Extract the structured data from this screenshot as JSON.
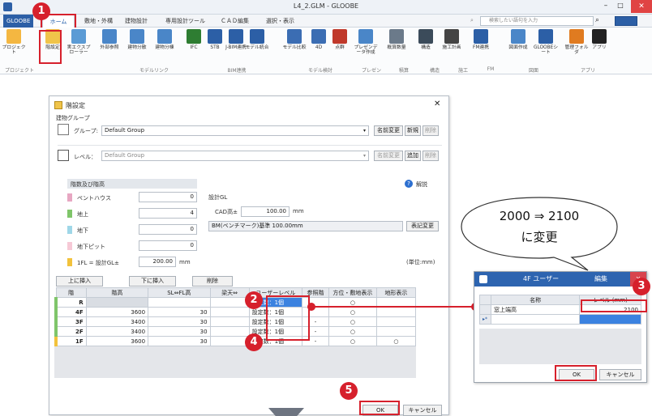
{
  "window_title": "L4_2.GLM - GLOOBE",
  "tabs": [
    "GLOOBE",
    "ホーム",
    "敷地・外構",
    "建物設計",
    "専用設計ツール",
    "ＣＡＤ編集",
    "選択・表示"
  ],
  "search_placeholder": "検索したい語句を入力",
  "ribbon": {
    "buttons": [
      "プロジェクト",
      "階設定",
      "実エクスプローラー",
      "外部参照",
      "建物分散",
      "建物分棟",
      "IFC",
      "STB",
      "J-BIM連携",
      "モデル統合",
      "モデル比較",
      "4D",
      "点群",
      "プレゼンデータ作成",
      "概算数量",
      "構造",
      "施工計画",
      "FM連携",
      "図面作成",
      "GLOOBEシート",
      "管理フォルダ",
      "アプリ"
    ],
    "groups": [
      "プロジェクト",
      "モデルリンク",
      "BIM連携",
      "モデル検討",
      "プレゼン",
      "積算",
      "構造",
      "施工",
      "FM",
      "図面",
      "アプリ"
    ]
  },
  "dialog": {
    "title": "階設定",
    "building_group_label": "建物グループ",
    "group_label": "グループ:",
    "group_value": "Default Group",
    "rename_btn": "名前変更",
    "new_btn": "新規",
    "delete_btn": "削除",
    "level_label": "レベル：",
    "level_value": "Default Group",
    "add_btn": "追加",
    "floors_header": "階数及び階高",
    "help": "解説",
    "penthouse_label": "ペントハウス",
    "penthouse_value": "0",
    "above_label": "地上",
    "above_value": "4",
    "below_label": "地下",
    "below_value": "0",
    "pit_label": "地下ピット",
    "pit_value": "0",
    "fl_label": "1FL = 設計GL±",
    "fl_value": "200.00",
    "fl_unit": "mm",
    "design_gl_label": "設計GL",
    "cad_label": "CAD高±",
    "cad_value": "100.00",
    "cad_unit": "mm",
    "bm_text": "BM(ベンチマーク)基準 100.00mm",
    "notation_btn": "表記変更",
    "unit_note": "(単位:mm)",
    "insert_above_btn": "上に挿入",
    "insert_below_btn": "下に挿入",
    "delete_row_btn": "削除",
    "columns": [
      "階",
      "階高",
      "SL⇔FL高",
      "梁天⇔",
      "ユーザーレベル",
      "参照階",
      "方位・敷地表示",
      "地形表示"
    ],
    "rows": [
      {
        "floor": "R",
        "height": "",
        "sl": "",
        "beam": "",
        "user": "設定数：1個",
        "ref": "",
        "site": "○",
        "terrain": ""
      },
      {
        "floor": "4F",
        "height": "3600",
        "sl": "30",
        "beam": "",
        "user": "設定数：1個",
        "ref": "",
        "site": "○",
        "terrain": ""
      },
      {
        "floor": "3F",
        "height": "3400",
        "sl": "30",
        "beam": "",
        "user": "設定数：1個",
        "ref": "-",
        "site": "○",
        "terrain": ""
      },
      {
        "floor": "2F",
        "height": "3400",
        "sl": "30",
        "beam": "",
        "user": "設定数：1個",
        "ref": "-",
        "site": "○",
        "terrain": ""
      },
      {
        "floor": "1F",
        "height": "3600",
        "sl": "30",
        "beam": "",
        "user": "設定数：1個",
        "ref": "-",
        "site": "○",
        "terrain": "○"
      }
    ],
    "ok_btn": "OK",
    "cancel_btn": "キャンセル"
  },
  "sub_dialog": {
    "title": "4F ユーザー",
    "title_tail": "編集",
    "col_name": "名称",
    "col_level": "レベル (mm)",
    "row_name": "窓上端高",
    "row_level": "2100",
    "ok_btn": "OK",
    "cancel_btn": "キャンセル"
  },
  "callout": {
    "line1": "2000 ⇒ 2100",
    "line2": "に変更"
  },
  "badges": [
    "1",
    "2",
    "3",
    "4",
    "5"
  ],
  "colors": {
    "accent_red": "#d6202c",
    "ribbon_blue": "#2c5fa6"
  }
}
